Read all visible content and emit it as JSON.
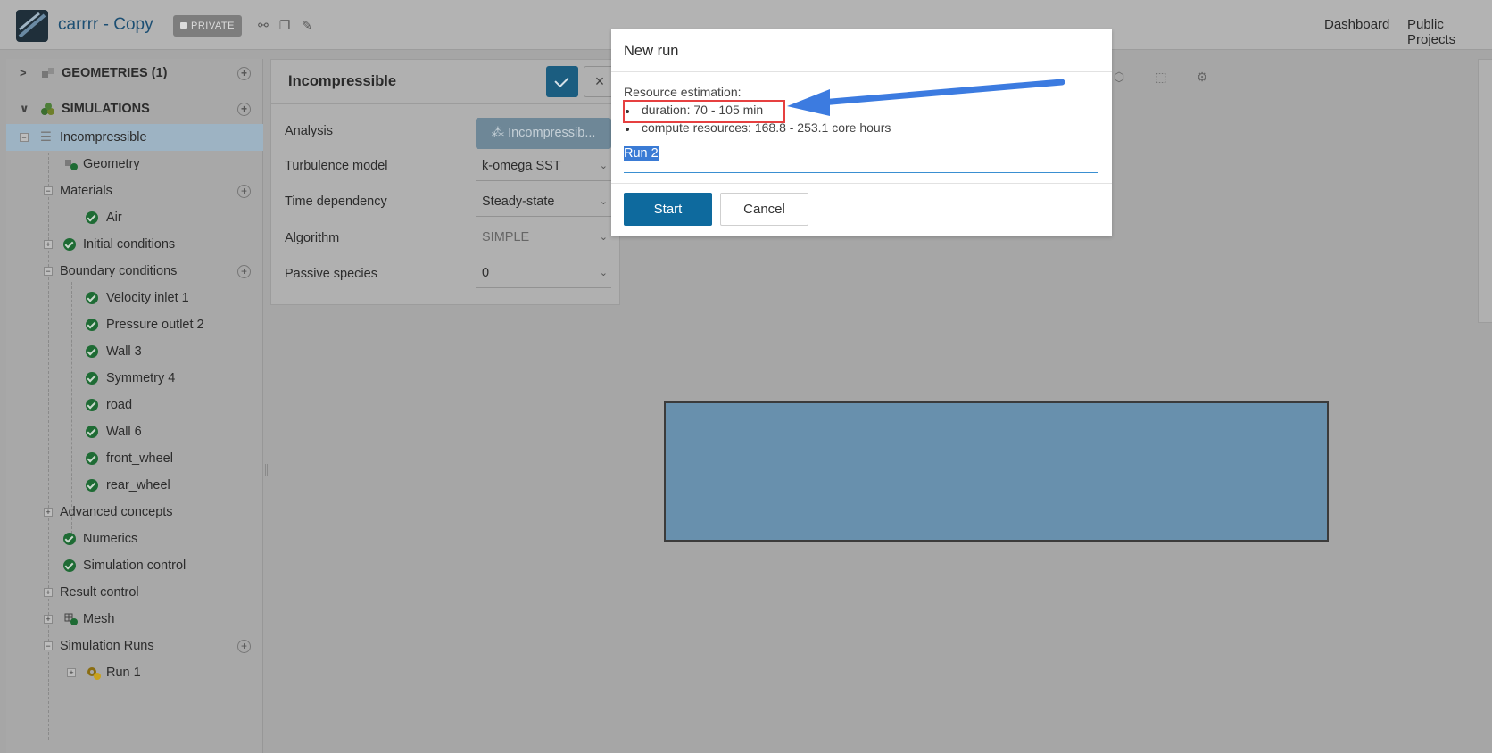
{
  "topbar": {
    "project_title": "carrrr - Copy",
    "private_badge": "PRIVATE",
    "nav": [
      "Dashboard",
      "Public Projects"
    ]
  },
  "tree": {
    "geometries_label": "GEOMETRIES (1)",
    "simulations_label": "SIMULATIONS",
    "items": {
      "incompressible": "Incompressible",
      "geometry": "Geometry",
      "materials": "Materials",
      "air": "Air",
      "initial_conditions": "Initial conditions",
      "boundary_conditions": "Boundary conditions",
      "velocity_inlet": "Velocity inlet 1",
      "pressure_outlet": "Pressure outlet 2",
      "wall3": "Wall 3",
      "symmetry4": "Symmetry 4",
      "road": "road",
      "wall6": "Wall 6",
      "front_wheel": "front_wheel",
      "rear_wheel": "rear_wheel",
      "advanced_concepts": "Advanced concepts",
      "numerics": "Numerics",
      "simulation_control": "Simulation control",
      "result_control": "Result control",
      "mesh": "Mesh",
      "simulation_runs": "Simulation Runs",
      "run1": "Run 1"
    }
  },
  "settings": {
    "title": "Incompressible",
    "fields": {
      "analysis_label": "Analysis",
      "analysis_value": "Incompressib...",
      "turbulence_label": "Turbulence model",
      "turbulence_value": "k-omega SST",
      "time_label": "Time dependency",
      "time_value": "Steady-state",
      "algorithm_label": "Algorithm",
      "algorithm_value": "SIMPLE",
      "passive_label": "Passive species",
      "passive_value": "0"
    }
  },
  "modal": {
    "title": "New run",
    "resource_label": "Resource estimation:",
    "duration": "duration: 70 - 105 min",
    "compute": "compute resources: 168.8 - 253.1 core hours",
    "run_name": "Run 2",
    "start_label": "Start",
    "cancel_label": "Cancel"
  },
  "colors": {
    "accent": "#0e6a9e",
    "annotation_arrow": "#3c7be0",
    "annotation_box": "#e64040"
  }
}
